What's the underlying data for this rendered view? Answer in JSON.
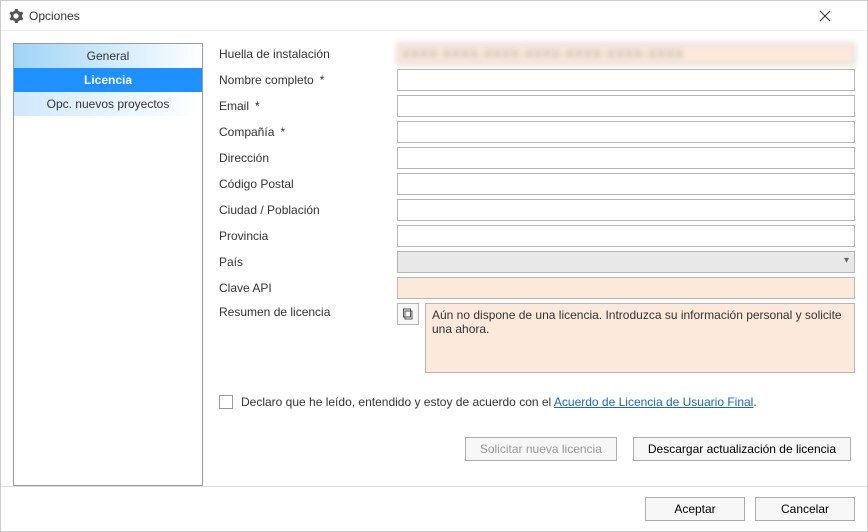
{
  "window": {
    "title": "Opciones"
  },
  "sidebar": {
    "items": [
      {
        "label": "General"
      },
      {
        "label": "Licencia"
      },
      {
        "label": "Opc. nuevos proyectos"
      }
    ]
  },
  "form": {
    "installation_fingerprint": {
      "label": "Huella de instalación",
      "value": "XXXX-XXXX-XXXX-XXXX-XXXX-XXXX-XXXX"
    },
    "full_name": {
      "label": "Nombre completo",
      "required": "*",
      "value": ""
    },
    "email": {
      "label": "Email",
      "required": "*",
      "value": ""
    },
    "company": {
      "label": "Compañía",
      "required": "*",
      "value": ""
    },
    "address": {
      "label": "Dirección",
      "value": ""
    },
    "postal": {
      "label": "Código Postal",
      "value": ""
    },
    "city": {
      "label": "Ciudad / Población",
      "value": ""
    },
    "province": {
      "label": "Provincia",
      "value": ""
    },
    "country": {
      "label": "País",
      "selected": ""
    },
    "api_key": {
      "label": "Clave API",
      "value": ""
    },
    "summary": {
      "label": "Resumen de licencia",
      "text": "Aún no dispone de una licencia. Introduzca su información personal y solicite una ahora."
    }
  },
  "declare": {
    "text_prefix": "Declaro que he leído, entendido y estoy de acuerdo con el ",
    "link_text": "Acuerdo de Licencia de Usuario Final",
    "text_suffix": "."
  },
  "buttons": {
    "request_license": "Solicitar nueva licencia",
    "download_update": "Descargar actualización de licencia",
    "accept": "Aceptar",
    "cancel": "Cancelar"
  }
}
